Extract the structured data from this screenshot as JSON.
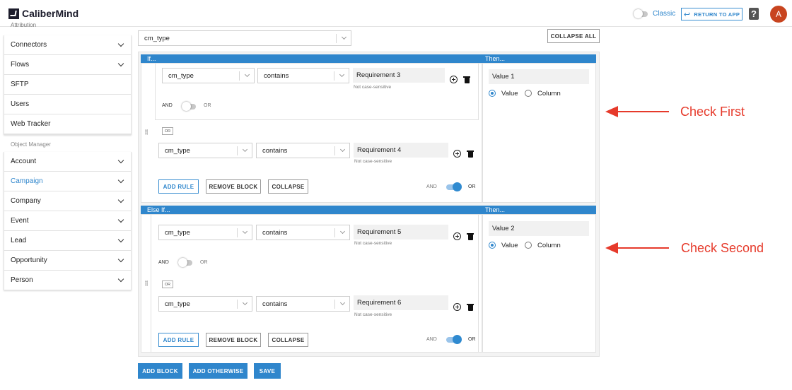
{
  "app": {
    "title": "CaliberMind",
    "classic_label": "Classic",
    "return_label": "RETURN TO APP",
    "help_symbol": "?",
    "avatar_letter": "A",
    "accent_color": "#2f86cc",
    "avatar_color": "#c8441f"
  },
  "sidebar": {
    "cut_section_label": "Attribution",
    "items": [
      {
        "label": "Connectors",
        "has_chevron": true
      },
      {
        "label": "Flows",
        "has_chevron": true
      },
      {
        "label": "SFTP",
        "has_chevron": false
      },
      {
        "label": "Users",
        "has_chevron": false
      },
      {
        "label": "Web Tracker",
        "has_chevron": false
      }
    ],
    "object_manager_label": "Object Manager",
    "object_items": [
      {
        "label": "Account",
        "active": false
      },
      {
        "label": "Campaign",
        "active": true
      },
      {
        "label": "Company",
        "active": false
      },
      {
        "label": "Event",
        "active": false
      },
      {
        "label": "Lead",
        "active": false
      },
      {
        "label": "Opportunity",
        "active": false
      },
      {
        "label": "Person",
        "active": false
      }
    ]
  },
  "main": {
    "field_select": "cm_type",
    "collapse_all_label": "COLLAPSE ALL",
    "if_header": "If...",
    "else_if_header": "Else If...",
    "then_header": "Then...",
    "not_case_sensitive": "Not case-sensitive",
    "and_label": "AND",
    "or_label": "OR",
    "add_rule_label": "ADD RULE",
    "remove_block_label": "REMOVE BLOCK",
    "collapse_label": "COLLAPSE",
    "value_radio_label": "Value",
    "column_radio_label": "Column",
    "blocks": [
      {
        "rule1": {
          "field": "cm_type",
          "operator": "contains",
          "value": "Requirement 3"
        },
        "rule2": {
          "field": "cm_type",
          "operator": "contains",
          "value": "Requirement 4"
        },
        "then_value": "Value 1"
      },
      {
        "rule1": {
          "field": "cm_type",
          "operator": "contains",
          "value": "Requirement 5"
        },
        "rule2": {
          "field": "cm_type",
          "operator": "contains",
          "value": "Requirement 6"
        },
        "then_value": "Value 2"
      }
    ],
    "add_block_label": "ADD BLOCK",
    "add_otherwise_label": "ADD OTHERWISE",
    "save_label": "SAVE"
  },
  "annotations": {
    "first": "Check First",
    "second": "Check Second",
    "color": "#e63a2b"
  }
}
